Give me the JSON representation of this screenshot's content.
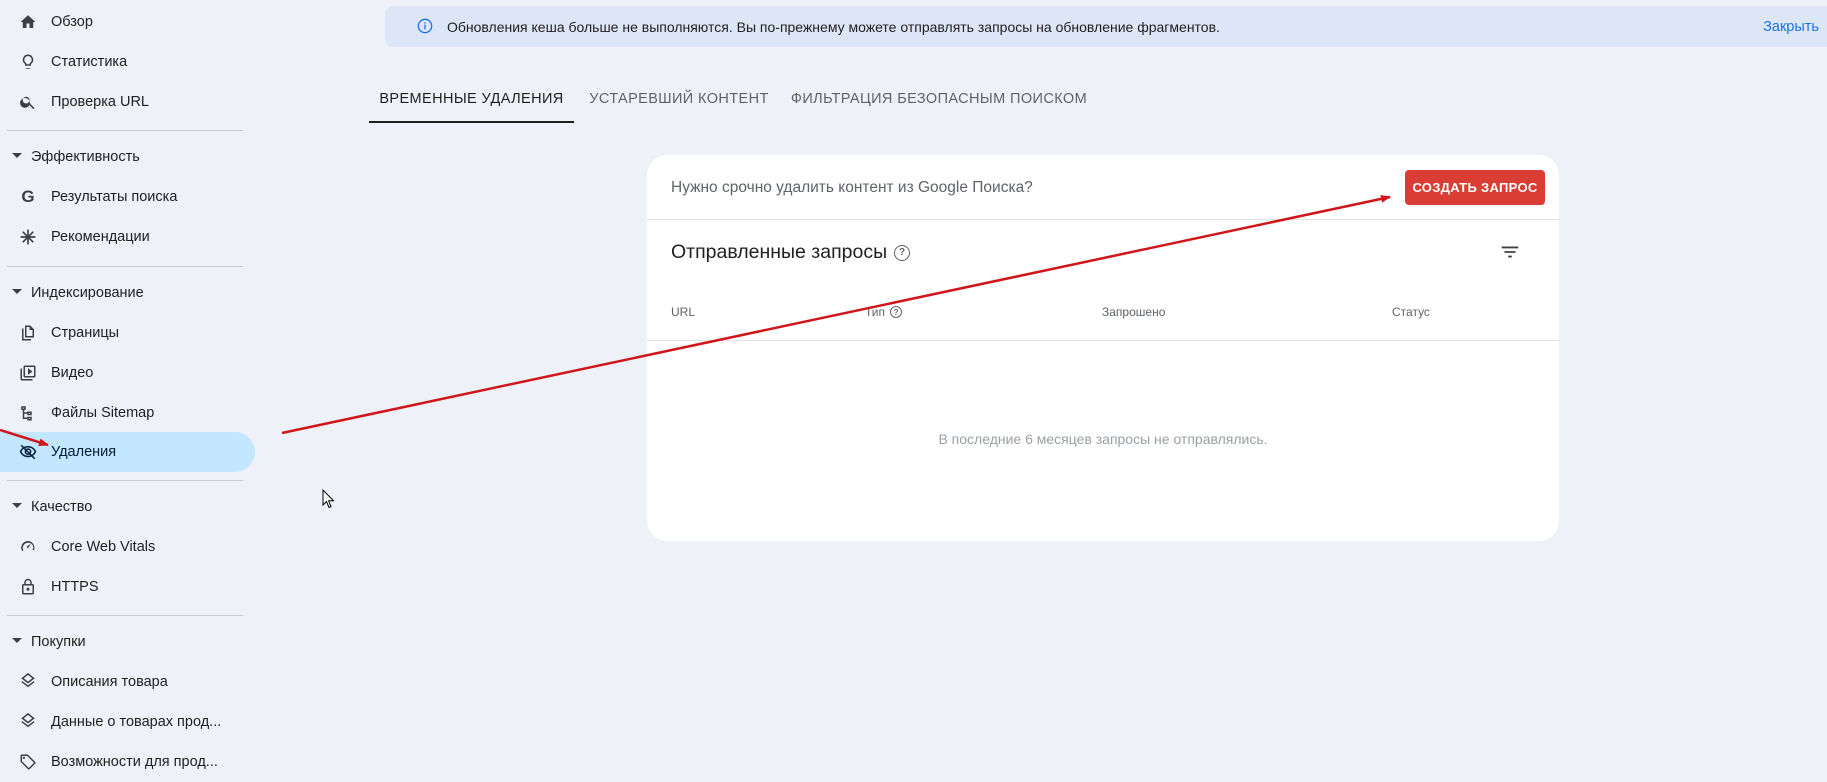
{
  "sidebar": {
    "items": [
      {
        "label": "Обзор"
      },
      {
        "label": "Статистика"
      },
      {
        "label": "Проверка URL"
      },
      {
        "label": "Результаты поиска"
      },
      {
        "label": "Рекомендации"
      },
      {
        "label": "Страницы"
      },
      {
        "label": "Видео"
      },
      {
        "label": "Файлы Sitemap"
      },
      {
        "label": "Удаления"
      },
      {
        "label": "Core Web Vitals"
      },
      {
        "label": "HTTPS"
      },
      {
        "label": "Описания товара"
      },
      {
        "label": "Данные о товарах прод..."
      },
      {
        "label": "Возможности для прод..."
      }
    ],
    "sections": [
      {
        "label": "Эффективность"
      },
      {
        "label": "Индексирование"
      },
      {
        "label": "Качество"
      },
      {
        "label": "Покупки"
      }
    ]
  },
  "banner": {
    "text": "Обновления кеша больше не выполняются. Вы по-прежнему можете отправлять запросы на обновление фрагментов.",
    "close_label": "Закрыть"
  },
  "tabs": [
    {
      "label": "ВРЕМЕННЫЕ УДАЛЕНИЯ"
    },
    {
      "label": "УСТАРЕВШИЙ КОНТЕНТ"
    },
    {
      "label": "ФИЛЬТРАЦИЯ БЕЗОПАСНЫМ ПОИСКОМ"
    }
  ],
  "card": {
    "prompt": "Нужно срочно удалить контент из Google Поиска?",
    "create_button": "СОЗДАТЬ ЗАПРОС",
    "title": "Отправленные запросы",
    "help_glyph": "?",
    "columns": [
      "URL",
      "Тип",
      "Запрошено",
      "Статус"
    ],
    "empty_text": "В последние 6 месяцев запросы не отправлялись."
  },
  "colors": {
    "accent": "#d93d34",
    "active_nav": "#c2e7ff",
    "banner_bg": "#dde6f7",
    "link": "#1a73e8",
    "annotation_arrow": "#d0161b"
  }
}
